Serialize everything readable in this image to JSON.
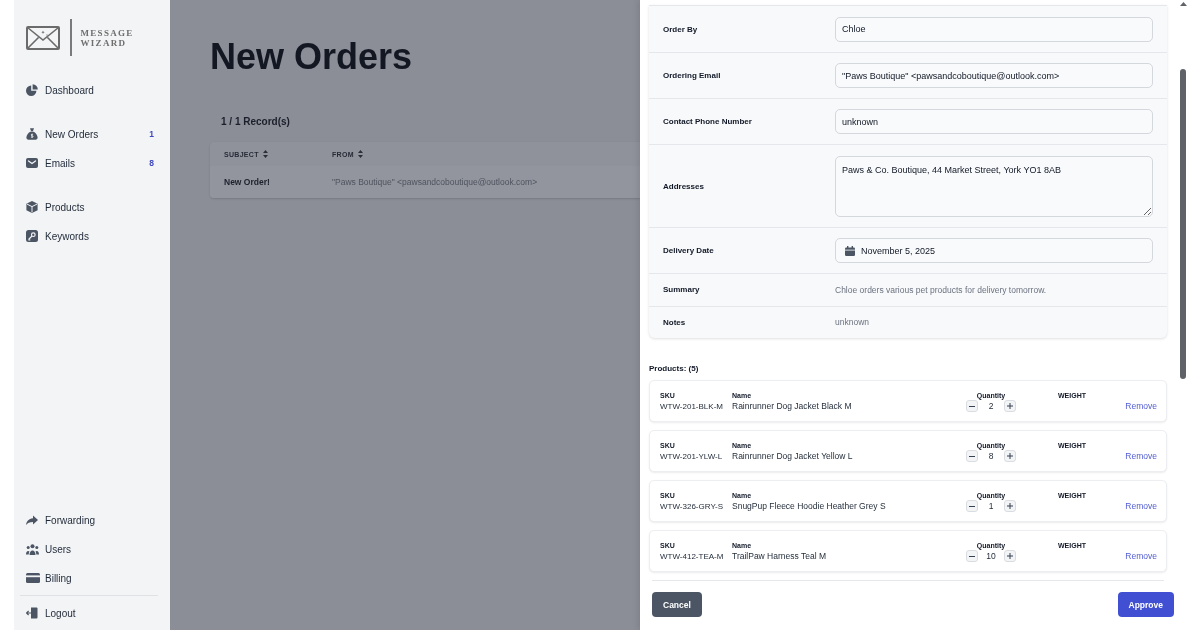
{
  "sidebar": {
    "brand": "MESSAGE WIZARD",
    "nav_groups": [
      {
        "items": [
          {
            "label": "Dashboard"
          }
        ]
      },
      {
        "items": [
          {
            "label": "New Orders",
            "badge": "1"
          },
          {
            "label": "Emails",
            "badge": "8"
          }
        ]
      },
      {
        "items": [
          {
            "label": "Products"
          },
          {
            "label": "Keywords"
          }
        ]
      }
    ],
    "bottom_groups": [
      {
        "items": [
          {
            "label": "Forwarding"
          },
          {
            "label": "Users"
          },
          {
            "label": "Billing"
          }
        ]
      },
      {
        "items": [
          {
            "label": "Logout"
          }
        ]
      }
    ]
  },
  "page": {
    "title": "New Orders",
    "record_count": "1 / 1 Record(s)",
    "table": {
      "columns": [
        "SUBJECT",
        "FROM"
      ],
      "rows": [
        [
          "New Order!",
          "\"Paws Boutique\" <pawsandcoboutique@outlook.com>"
        ]
      ]
    }
  },
  "order_panel": {
    "fields": [
      {
        "label": "Order By",
        "kind": "input",
        "value": "Chloe"
      },
      {
        "label": "Ordering Email",
        "kind": "input",
        "value": "\"Paws Boutique\" <pawsandcoboutique@outlook.com>"
      },
      {
        "label": "Contact Phone Number",
        "kind": "input",
        "value": "unknown"
      },
      {
        "label": "Addresses",
        "kind": "textarea",
        "value": "Paws & Co. Boutique, 44 Market Street, York YO1 8AB"
      },
      {
        "label": "Delivery Date",
        "kind": "date",
        "value": "November 5, 2025"
      },
      {
        "label": "Summary",
        "kind": "text",
        "value": "Chloe orders various pet products for delivery tomorrow."
      },
      {
        "label": "Notes",
        "kind": "text",
        "value": "unknown"
      }
    ],
    "products_heading": "Products: (5)",
    "products": [
      {
        "sku_label": "SKU",
        "sku": "WTW-201-BLK-M",
        "name_label": "Name",
        "name": "Rainrunner Dog Jacket Black M",
        "quantity_label": "Quantity",
        "quantity": "2",
        "weight_label": "WEIGHT",
        "action": "Remove"
      },
      {
        "sku_label": "SKU",
        "sku": "WTW-201-YLW-L",
        "name_label": "Name",
        "name": "Rainrunner Dog Jacket Yellow L",
        "quantity_label": "Quantity",
        "quantity": "8",
        "weight_label": "WEIGHT",
        "action": "Remove"
      },
      {
        "sku_label": "SKU",
        "sku": "WTW-326-GRY-S",
        "name_label": "Name",
        "name": "SnugPup Fleece Hoodie Heather Grey S",
        "quantity_label": "Quantity",
        "quantity": "1",
        "weight_label": "WEIGHT",
        "action": "Remove"
      },
      {
        "sku_label": "SKU",
        "sku": "WTW-412-TEA-M",
        "name_label": "Name",
        "name": "TrailPaw Harness Teal M",
        "quantity_label": "Quantity",
        "quantity": "10",
        "weight_label": "WEIGHT",
        "action": "Remove"
      }
    ],
    "buttons": [
      {
        "label": "Cancel",
        "kind": "secondary"
      },
      {
        "label": "Approve",
        "kind": "primary"
      }
    ]
  }
}
